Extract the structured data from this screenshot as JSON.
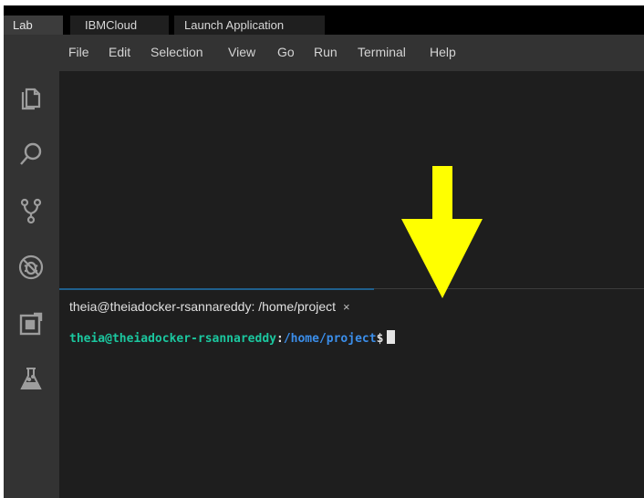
{
  "browser_tabs": [
    "Lab",
    "IBMCloud",
    "Launch Application"
  ],
  "menu": [
    "File",
    "Edit",
    "Selection",
    "View",
    "Go",
    "Run",
    "Terminal",
    "Help"
  ],
  "activity_bar": [
    "explorer-icon",
    "search-icon",
    "source-control-icon",
    "debug-icon",
    "extensions-icon",
    "lab-flask-icon"
  ],
  "terminal": {
    "tab_title": "theia@theiadocker-rsannareddy: /home/project",
    "close_glyph": "×",
    "prompt_user": "theia@theiadocker-rsannareddy",
    "prompt_colon": ":",
    "prompt_path": "/home/project",
    "prompt_dollar": "$"
  },
  "annotation": {
    "color": "#ffff00",
    "shape": "down-arrow"
  }
}
